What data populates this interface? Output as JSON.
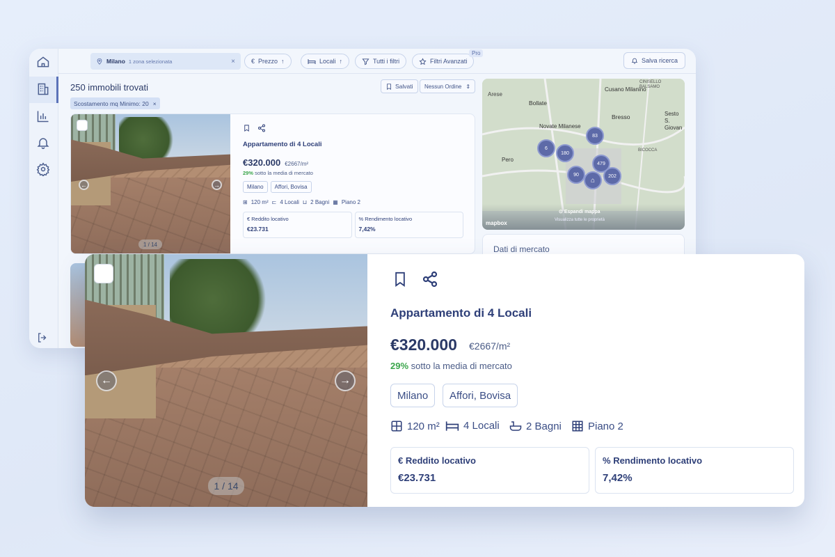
{
  "topbar": {
    "location": "Milano",
    "location_sub": "1 zona selezionata",
    "filters": [
      "Prezzo",
      "Locali",
      "Tutti i filtri",
      "Filtri Avanzati"
    ],
    "pro_badge": "Pro",
    "save_search": "Salva ricerca"
  },
  "results": {
    "count_label": "250 immobili trovati",
    "active_filter": "Scostamento mq Minimo: 20",
    "saved_label": "Salvati",
    "order_label": "Nessun Ordine"
  },
  "map": {
    "places": [
      "Arese",
      "Bollate",
      "Cusano Milanino",
      "Bresso",
      "Novate Milanese",
      "Sesto S. Giovan",
      "Pero",
      "CINISELLO BALSAMO",
      "BICOCCA"
    ],
    "clusters": [
      "6",
      "180",
      "83",
      "90",
      "479",
      "202"
    ],
    "expand_label": "Espandi mappa",
    "expand_sub": "Visualizza tutte le proprietà",
    "brand": "mapbox"
  },
  "market_panel": {
    "title": "Dati di mercato"
  },
  "listing": {
    "title": "Appartamento di 4 Locali",
    "price": "€320.000",
    "price_per_m2": "€2667/m²",
    "below_pct": "29%",
    "below_text": "sotto la media di mercato",
    "tags": [
      "Milano",
      "Affori, Bovisa"
    ],
    "features": {
      "area": "120 m²",
      "rooms": "4 Locali",
      "baths": "2 Bagni",
      "floor": "Piano 2"
    },
    "income_label": "Reddito locativo",
    "income_symbol": "€",
    "income_value": "€23.731",
    "yield_label": "Rendimento locativo",
    "yield_symbol": "%",
    "yield_value": "7,42%",
    "photo_counter": "1 / 14"
  },
  "colors": {
    "accent": "#2e3f78",
    "positive": "#3aa54a",
    "cluster": "#5d6aa8"
  }
}
